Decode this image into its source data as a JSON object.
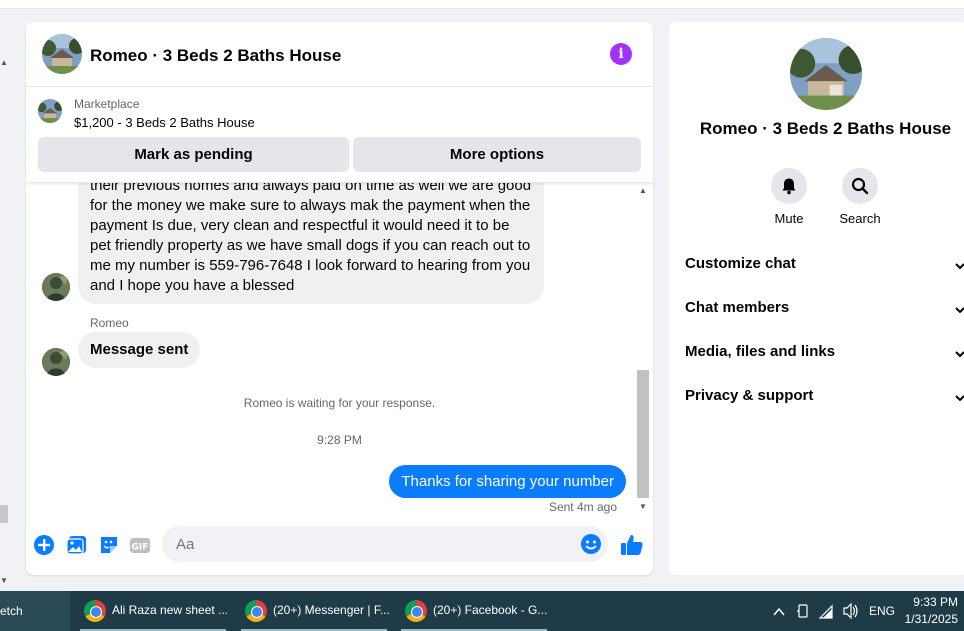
{
  "chat": {
    "title": "Romeo · 3 Beds 2 Baths House",
    "listing": {
      "label": "Marketplace",
      "price_title": "$1,200 - 3 Beds 2 Baths House",
      "mark_pending_label": "Mark as pending",
      "more_options_label": "More options"
    },
    "messages": {
      "long_text": "their previous homes and always paid on time as well we are good for the money we make sure to always mak the payment when the payment Is due, very clean and respectful it would need it to be pet friendly property as we have small dogs if you can reach out to me my number is 559-796-7648 I look forward to hearing from you and I hope you have a blessed",
      "sender_name": "Romeo",
      "message_sent_text": "Message sent",
      "waiting_note": "Romeo is waiting for your response.",
      "time_stamp": "9:28 PM",
      "outgoing_text": "Thanks for sharing your number",
      "sent_status": "Sent 4m ago"
    },
    "composer": {
      "placeholder": "Aa"
    }
  },
  "right_panel": {
    "title": "Romeo · 3 Beds 2 Baths House",
    "mute_label": "Mute",
    "search_label": "Search",
    "sections": [
      "Customize chat",
      "Chat members",
      "Media, files and links",
      "Privacy & support"
    ]
  },
  "taskbar": {
    "first_label": "etch",
    "items": [
      "Ali Raza new sheet ...",
      "(20+) Messenger | F...",
      "(20+) Facebook - G..."
    ],
    "language": "ENG",
    "time": "9:33 PM",
    "date": "1/31/2025"
  },
  "colors": {
    "accent_blue": "#0a7cff",
    "info_purple": "#a033ff",
    "taskbar": "#1f3b48"
  }
}
